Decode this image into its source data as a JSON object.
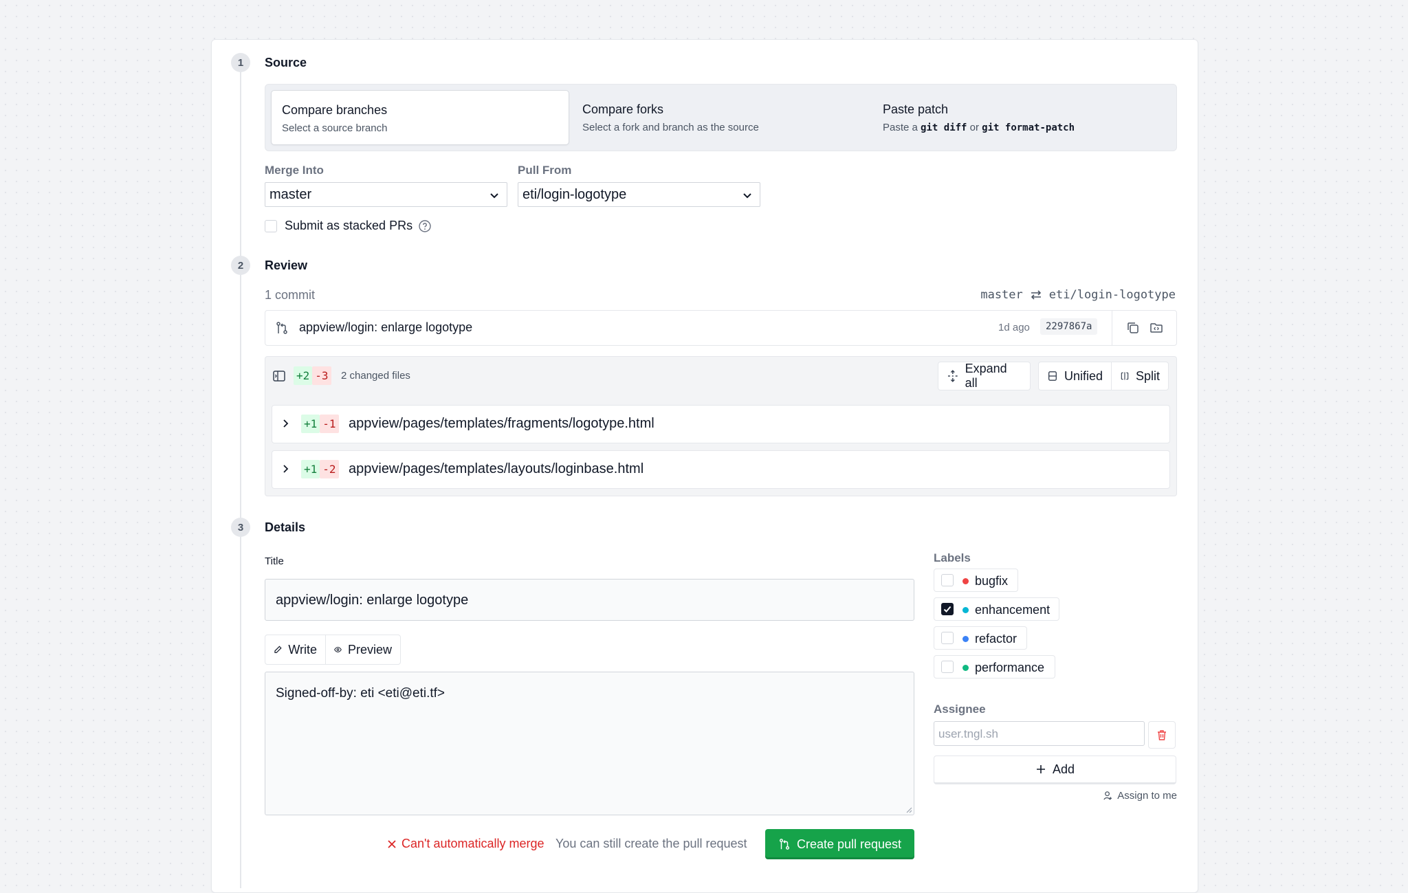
{
  "steps": [
    {
      "num": "1",
      "title": "Source"
    },
    {
      "num": "2",
      "title": "Review"
    },
    {
      "num": "3",
      "title": "Details"
    }
  ],
  "source": {
    "tabs": [
      {
        "title": "Compare branches",
        "desc": "Select a source branch"
      },
      {
        "title": "Compare forks",
        "desc": "Select a fork and branch as the source"
      },
      {
        "title": "Paste patch",
        "desc_pre": "Paste a",
        "code1": "git diff",
        "desc_mid": "or",
        "code2": "git format-patch"
      }
    ],
    "merge_into_label": "Merge Into",
    "merge_into_value": "master",
    "pull_from_label": "Pull From",
    "pull_from_value": "eti/login-logotype",
    "stacked_label": "Submit as stacked PRs"
  },
  "review": {
    "commit_count": "1 commit",
    "base_branch": "master",
    "head_branch": "eti/login-logotype",
    "commit": {
      "message": "appview/login: enlarge logotype",
      "age": "1d ago",
      "sha": "2297867a"
    },
    "diff": {
      "additions": "+2",
      "deletions": "-3",
      "changed_files": "2 changed files",
      "expand_all": "Expand all",
      "unified": "Unified",
      "split": "Split",
      "files": [
        {
          "add": "+1",
          "del": "-1",
          "path": "appview/pages/templates/fragments/logotype.html"
        },
        {
          "add": "+1",
          "del": "-2",
          "path": "appview/pages/templates/layouts/loginbase.html"
        }
      ]
    }
  },
  "details": {
    "title_label": "Title",
    "title_value": "appview/login: enlarge logotype",
    "write_tab": "Write",
    "preview_tab": "Preview",
    "body_value": "Signed-off-by: eti <eti@eti.tf>",
    "labels_heading": "Labels",
    "labels": [
      {
        "name": "bugfix",
        "color": "#ef4444",
        "checked": false
      },
      {
        "name": "enhancement",
        "color": "#06b6d4",
        "checked": true
      },
      {
        "name": "refactor",
        "color": "#3b82f6",
        "checked": false
      },
      {
        "name": "performance",
        "color": "#10b981",
        "checked": false
      }
    ],
    "assignee_heading": "Assignee",
    "assignee_placeholder": "user.tngl.sh",
    "add_label": "Add",
    "assign_to_me": "Assign to me",
    "merge_error": "Can't automatically merge",
    "merge_hint": "You can still create the pull request",
    "create_button": "Create pull request"
  },
  "colors": {
    "accent_green": "#16a34a",
    "error_red": "#dc2626"
  }
}
